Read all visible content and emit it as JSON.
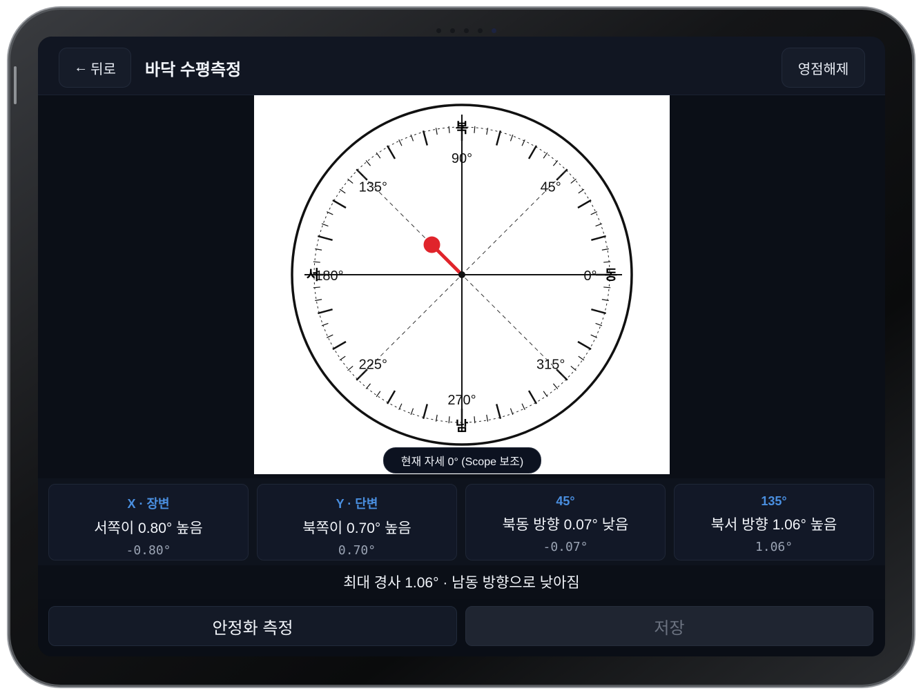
{
  "header": {
    "back_label": "뒤로",
    "back_arrow": "←",
    "title": "바닥 수평측정",
    "zero_label": "영점해제"
  },
  "dial": {
    "north_label": "북",
    "south_label": "남",
    "east_label": "동",
    "west_label": "서",
    "angle_labels": [
      "0°",
      "45°",
      "90°",
      "135°",
      "180°",
      "225°",
      "270°",
      "315°"
    ],
    "bubble_direction_deg": 135,
    "bubble_magnitude_deg": 1.06,
    "bubble_color": "#e0242b",
    "attitude_text": "현재 자세 0° (Scope 보조)"
  },
  "cards": [
    {
      "label": "X · 장변",
      "text": "서쪽이 0.80° 높음",
      "value": "-0.80°"
    },
    {
      "label": "Y · 단변",
      "text": "북쪽이 0.70° 높음",
      "value": "0.70°"
    },
    {
      "label": "45°",
      "text": "북동 방향 0.07° 낮음",
      "value": "-0.07°"
    },
    {
      "label": "135°",
      "text": "북서 방향 1.06° 높음",
      "value": "1.06°"
    }
  ],
  "summary": "최대 경사 1.06° · 남동 방향으로 낮아짐",
  "actions": {
    "measure_label": "안정화 측정",
    "save_label": "저장"
  },
  "colors": {
    "accent": "#4a8fe0",
    "background": "#0b0f17",
    "bubble": "#e0242b"
  }
}
